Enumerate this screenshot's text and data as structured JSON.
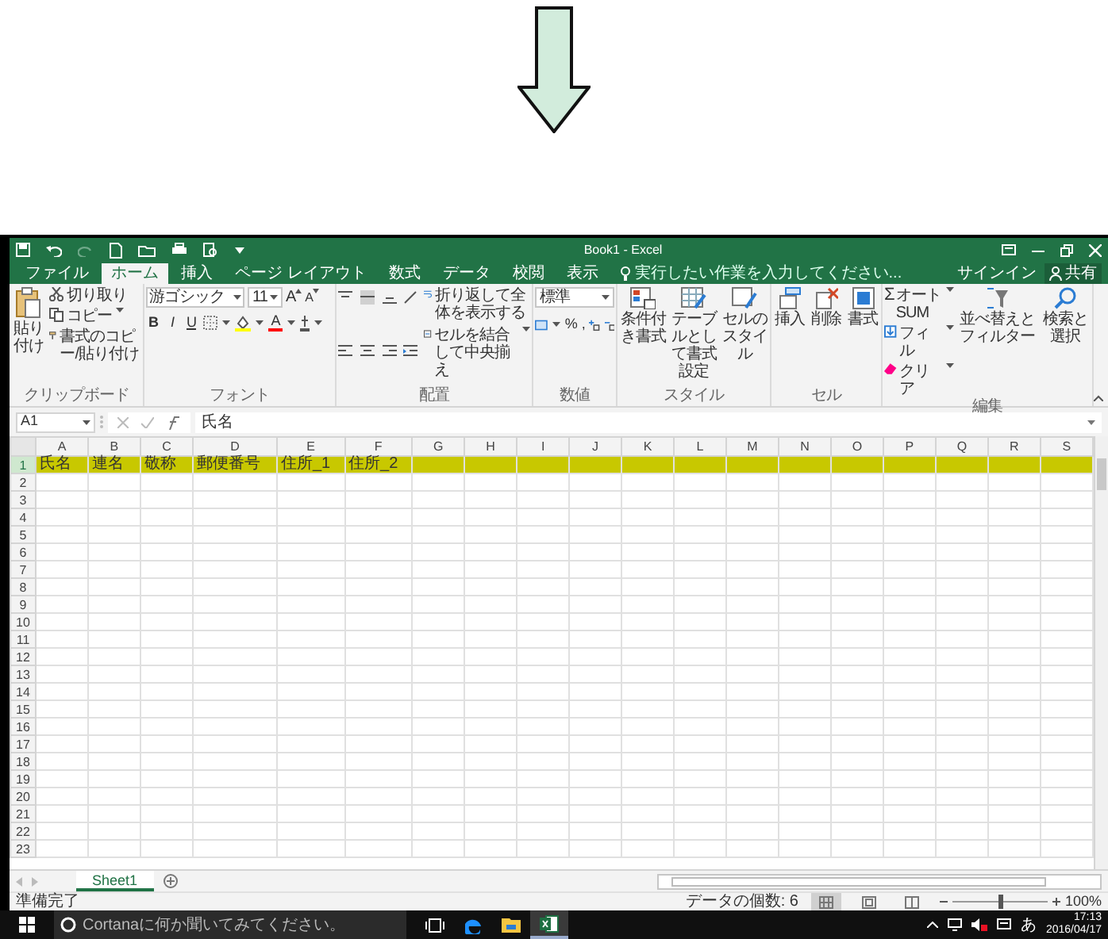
{
  "window": {
    "title": "Book1 - Excel"
  },
  "tabs": [
    {
      "label": "ファイル",
      "selected": false
    },
    {
      "label": "ホーム",
      "selected": true
    },
    {
      "label": "挿入",
      "selected": false
    },
    {
      "label": "ページ レイアウト",
      "selected": false
    },
    {
      "label": "数式",
      "selected": false
    },
    {
      "label": "データ",
      "selected": false
    },
    {
      "label": "校閲",
      "selected": false
    },
    {
      "label": "表示",
      "selected": false
    }
  ],
  "tell_me": {
    "placeholder": "実行したい作業を入力してください..."
  },
  "account": {
    "sign_in": "サインイン",
    "share": "共有"
  },
  "ribbon": [
    {
      "kind": "clipboard",
      "label": "クリップボード",
      "paste": "貼り付け",
      "cut": "切り取り",
      "copy": "コピー",
      "format_painter": "書式のコピー/貼り付け"
    },
    {
      "kind": "font",
      "label": "フォント",
      "font_name": "游ゴシック",
      "font_size": "11",
      "grow": "A",
      "shrink": "A",
      "styles": [
        "B",
        "I",
        "U"
      ],
      "font_color": "A"
    },
    {
      "kind": "alignment",
      "label": "配置",
      "wrap_text": "折り返して全体を表示する",
      "merge_center": "セルを結合して中央揃え"
    },
    {
      "kind": "number",
      "label": "数値",
      "format": "標準",
      "percent": "%",
      "comma": ","
    },
    {
      "kind": "buttons",
      "label": "スタイル",
      "buttons": [
        {
          "kind": "conditional",
          "label": "条件付き書式"
        },
        {
          "kind": "table",
          "label": "テーブルとして書式設定"
        },
        {
          "kind": "cell-style",
          "label": "セルのスタイル"
        }
      ]
    },
    {
      "kind": "buttons",
      "label": "セル",
      "buttons": [
        {
          "kind": "insert",
          "label": "挿入"
        },
        {
          "kind": "delete",
          "label": "削除"
        },
        {
          "kind": "format",
          "label": "書式"
        }
      ]
    },
    {
      "kind": "editing",
      "label": "編集",
      "sigma": "Σ",
      "autosum": "オート SUM",
      "fill": "フィル",
      "clear": "クリア",
      "sort_filter": "並べ替えとフィルター",
      "find_select": "検索と選択"
    }
  ],
  "formula_bar": {
    "name_box": "A1",
    "formula": "氏名"
  },
  "columns": [
    "A",
    "B",
    "C",
    "D",
    "E",
    "F",
    "G",
    "H",
    "I",
    "J",
    "K",
    "L",
    "M",
    "N",
    "O",
    "P",
    "Q",
    "R",
    "S"
  ],
  "rows": [
    {
      "header": "1",
      "selected": true,
      "cells": [
        "氏名",
        "連名",
        "敬称",
        "郵便番号",
        "住所_1",
        "住所_2"
      ]
    },
    {
      "header": "2",
      "selected": false
    },
    {
      "header": "3",
      "selected": false
    },
    {
      "header": "4",
      "selected": false
    },
    {
      "header": "5",
      "selected": false
    },
    {
      "header": "6",
      "selected": false
    },
    {
      "header": "7",
      "selected": false
    },
    {
      "header": "8",
      "selected": false
    },
    {
      "header": "9",
      "selected": false
    },
    {
      "header": "10",
      "selected": false
    },
    {
      "header": "11",
      "selected": false
    },
    {
      "header": "12",
      "selected": false
    },
    {
      "header": "13",
      "selected": false
    },
    {
      "header": "14",
      "selected": false
    },
    {
      "header": "15",
      "selected": false
    },
    {
      "header": "16",
      "selected": false
    },
    {
      "header": "17",
      "selected": false
    },
    {
      "header": "18",
      "selected": false
    },
    {
      "header": "19",
      "selected": false
    },
    {
      "header": "20",
      "selected": false
    },
    {
      "header": "21",
      "selected": false
    },
    {
      "header": "22",
      "selected": false
    },
    {
      "header": "23",
      "selected": false
    }
  ],
  "sheet_tabs": [
    {
      "label": "Sheet1",
      "selected": true
    }
  ],
  "status_bar": {
    "ready": "準備完了",
    "count": "データの個数: 6",
    "views": [
      {
        "kind": "normal",
        "selected": true
      },
      {
        "kind": "page-layout",
        "selected": false
      },
      {
        "kind": "page-break",
        "selected": false
      }
    ],
    "zoom_slider": {
      "level": 0.5
    },
    "zoom": "100%"
  },
  "taskbar": {
    "search_placeholder": "Cortanaに何か聞いてみてください。",
    "apps": [
      {
        "kind": "task-view",
        "active": false
      },
      {
        "kind": "edge",
        "active": false
      },
      {
        "kind": "explorer",
        "active": false
      },
      {
        "kind": "excel",
        "active": true
      }
    ],
    "ime": "あ",
    "time": "17:13",
    "date": "2016/04/17"
  }
}
